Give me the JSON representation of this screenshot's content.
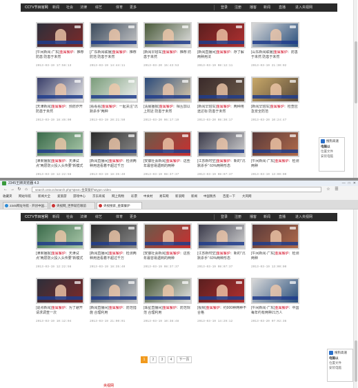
{
  "nav": {
    "left": [
      "CCTV节目官网",
      "新闻",
      "社会",
      "法律",
      "综艺",
      "体育",
      "更多"
    ],
    "right": [
      "登录",
      "注册",
      "播客",
      "新闻",
      "直播",
      "进入央视网"
    ]
  },
  "shot1": {
    "cards": [
      {
        "caption_prefix": "[午间新闻·广东]",
        "keyword": "金属餐炉",
        "caption_rest": "：推荐防患 防患于未然",
        "date": "2013-03-19 17:58:13"
      },
      {
        "caption_prefix": "[广东新闻联播]",
        "keyword": "金属餐炉",
        "caption_rest": "：推荐防范 防患于未然",
        "date": "2013-03-19 14:44:11"
      },
      {
        "caption_prefix": "[新闻早班车]",
        "keyword": "金属餐炉",
        "caption_rest": "：推荐 防患于未然",
        "date": "2013-03-20 15:43:53"
      },
      {
        "caption_prefix": "[新闻直播间]",
        "keyword": "金属餐炉",
        "caption_rest": "：存了解两种用法",
        "date": "2013-03-19 08:12:11"
      },
      {
        "caption_prefix": "[山东新闻联播]",
        "keyword": "金属餐炉",
        "caption_rest": "：防患于未然 防患于未然",
        "date": "2013-03-19 21:30:02"
      },
      {
        "caption_prefix": "[天津新闻]",
        "keyword": "金属餐炉",
        "caption_rest": "：预防炸开 防患于未然",
        "date": "2013-03-19 18:46:00"
      },
      {
        "caption_prefix": "[看看看]",
        "keyword": "金属餐炉",
        "caption_rest": "：一起关注“沉默杀手”两种",
        "date": "2013-03-19 20:21:50"
      },
      {
        "caption_prefix": "[清晨播报]",
        "keyword": "金属餐炉",
        "caption_rest": "：相互加以上附近 防患于未然",
        "date": "2013-03-20 06:17:19"
      },
      {
        "caption_prefix": "[新闻早班车]",
        "keyword": "金属餐炉",
        "caption_rest": "：两种用途达标 防患于未然",
        "date": "2013-03-20 08:30:17"
      },
      {
        "caption_prefix": "[新闻早班车]",
        "keyword": "金属餐炉",
        "caption_rest": "：检查应急安全防范",
        "date": "2013-03-20 10:24:47"
      },
      {
        "caption_prefix": "[津果播报]",
        "keyword": "金属餐炉",
        "caption_rest": "：天津试点“两层防火投入头传要”新模式",
        "date": "2013-03-19 12:22:56"
      },
      {
        "caption_prefix": "[新闻直播间]",
        "keyword": "金属餐炉",
        "caption_rest": "：检测两种用途看着不超过千万",
        "date": "2013-03-19 18:35:40"
      },
      {
        "caption_prefix": "[安徽社会新闻]",
        "keyword": "金属餐炉",
        "caption_rest": "：这些年最容易遇到的两种",
        "date": "2013-03-19 08:37:37"
      },
      {
        "caption_prefix": "[江苏新时空]",
        "keyword": "金属餐炉",
        "caption_rest": "：新的“沉默杀手” 60%两种形态",
        "date": "2013-03-19 08:07:37"
      },
      {
        "caption_prefix": "[午间新闻·广东]",
        "keyword": "金属餐炉",
        "caption_rest": "：检测两种",
        "date": "2013-03-19 13:00:00"
      }
    ]
  },
  "browser": {
    "title": "2345王牌浏览器 4.3",
    "window_buttons": [
      "—",
      "□",
      "✕"
    ],
    "url": "search.cntv.cn/search.php?qtext=金属餐炉&type=video",
    "favorites": [
      "收藏夹",
      "网站导航",
      "新闻大全",
      "爱旅游",
      "游戏中心",
      "京东商城",
      "网上购物",
      "彩票",
      "中关村",
      "易车网",
      "新浪网",
      "新闻",
      "中国税务",
      "百度一下",
      "大风网"
    ],
    "tabs": [
      "2345网址导航 - 开创中国...",
      "央视网_世界就在眼前",
      "央视搜索_金属餐炉"
    ]
  },
  "shot2": {
    "cards": [
      {
        "caption_prefix": "[津果播报]",
        "keyword": "金属餐炉",
        "caption_rest": "：天津试点“两层防火投入头传要”新模式",
        "date": "2013-03-19 12:22:56"
      },
      {
        "caption_prefix": "[新闻直播间]",
        "keyword": "金属餐炉",
        "caption_rest": "：检测两种用途看着不超过千万",
        "date": "2013-03-19 18:35:40"
      },
      {
        "caption_prefix": "[安徽社会新闻]",
        "keyword": "金属餐炉",
        "caption_rest": "：这些年最容易遇到的两种",
        "date": "2013-03-19 08:37:37"
      },
      {
        "caption_prefix": "[江苏新时空]",
        "keyword": "金属餐炉",
        "caption_rest": "：新的“沉默杀手” 60%两种形态",
        "date": "2013-03-19 08:07:37"
      },
      {
        "caption_prefix": "[午间新闻·广东]",
        "keyword": "金属餐炉",
        "caption_rest": "：检测两种",
        "date": "2013-03-19 13:00:00"
      },
      {
        "caption_prefix": "[说点新闻]",
        "keyword": "金属餐炉",
        "caption_rest": "：为了避开 请求调查一次",
        "date": "2013-03-19 10:12:04"
      },
      {
        "caption_prefix": "[新闻直播间]",
        "keyword": "金属餐炉",
        "caption_rest": "：防范措施 合理利用",
        "date": "2013-03-19 21:00:01"
      },
      {
        "caption_prefix": "[珠星直播间]",
        "keyword": "金属餐炉",
        "caption_rest": "：防范规范 合理利用",
        "date": "2013-03-19 10:38:48"
      },
      {
        "caption_prefix": "[视频]",
        "keyword": "金属餐炉",
        "caption_rest": "：约900种两种不合格",
        "date": "2013-03-19 14:29:12"
      },
      {
        "caption_prefix": "[午间新闻·广东]",
        "keyword": "金属餐炉",
        "caption_rest": "：中国每年约有两种21万人",
        "date": "2013-03-20 07:02:36"
      }
    ],
    "pagination": [
      "1",
      "2",
      "3",
      "4",
      "下一页"
    ]
  },
  "side_ad": {
    "title": "搜狗高速",
    "headline": "电脑以",
    "line1": "位置文件",
    "line2": "安装电脑"
  },
  "footer_peek": "央视网",
  "colors": {
    "keyword": "#d0021b",
    "active_page": "#f19a1e",
    "nav_bg": "#2b2b2b"
  }
}
